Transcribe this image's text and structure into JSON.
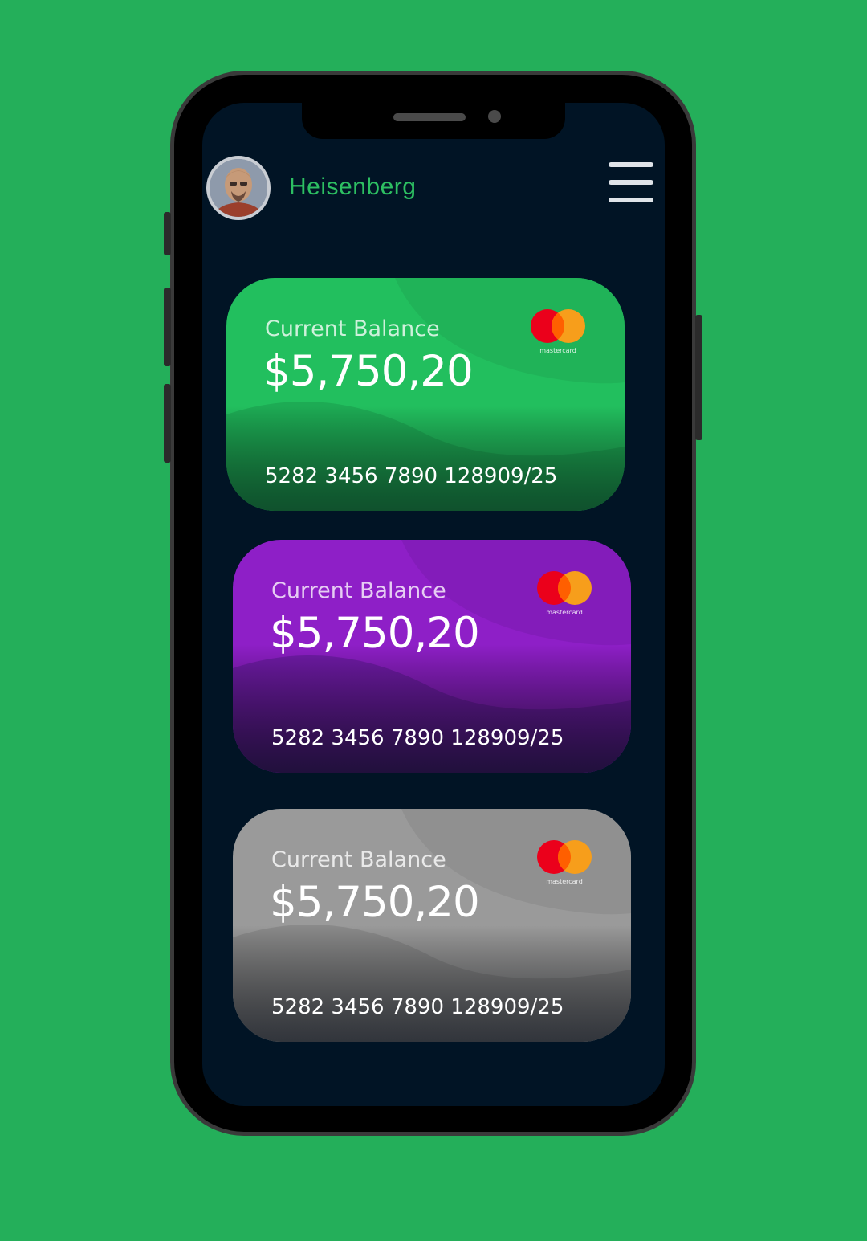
{
  "app": {
    "username": "Heisenberg"
  },
  "cards": [
    {
      "label": "Current Balance",
      "balance": "$5,750,20",
      "number": "5282 3456 7890 128909/25",
      "brand": "mastercard",
      "color": "#22bf5e"
    },
    {
      "label": "Current Balance",
      "balance": "$5,750,20",
      "number": "5282 3456 7890 128909/25",
      "brand": "mastercard",
      "color": "#8e1fc7"
    },
    {
      "label": "Current Balance",
      "balance": "$5,750,20",
      "number": "5282 3456 7890 128909/25",
      "brand": "mastercard",
      "color": "#9a9a9a"
    }
  ],
  "colors": {
    "background": "#24af5a",
    "screen": "#011425",
    "accent": "#2dbf62"
  },
  "icons": {
    "menu": "hamburger-menu-icon",
    "brand": "mastercard-logo-icon"
  }
}
